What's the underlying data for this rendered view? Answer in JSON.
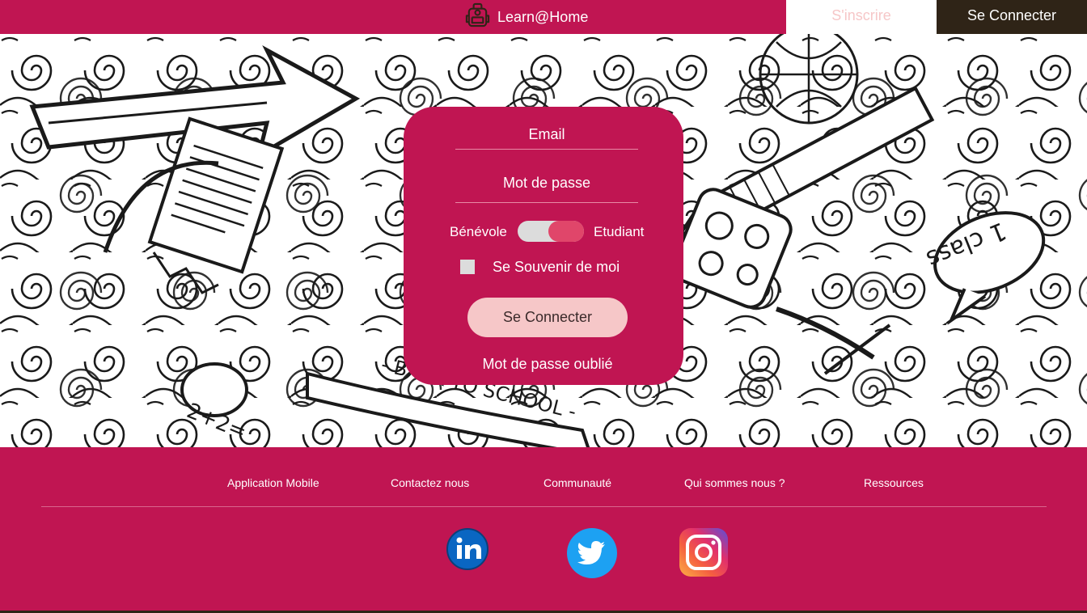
{
  "header": {
    "brand_name": "Learn@Home",
    "signup_label": "S'inscrire",
    "login_label": "Se Connecter"
  },
  "hero": {
    "illustration_text": {
      "back_to_school": "- BACK TO SCHOOL -",
      "math": "2+2=",
      "class": "1 class"
    }
  },
  "login_form": {
    "email_placeholder": "Email",
    "password_placeholder": "Mot de passe",
    "toggle_left_label": "Bénévole",
    "toggle_right_label": "Etudiant",
    "toggle_state": "Etudiant",
    "remember_label": "Se Souvenir de moi",
    "remember_checked": false,
    "submit_label": "Se Connecter",
    "forgot_label": "Mot de passe oublié"
  },
  "footer": {
    "links": [
      "Application Mobile",
      "Contactez nous",
      "Communauté",
      "Qui sommes nous ?",
      "Ressources"
    ],
    "social_icons": [
      "linkedin-icon",
      "twitter-icon",
      "instagram-icon"
    ]
  },
  "colors": {
    "brand": "#c01552",
    "dark": "#2f2417",
    "pink_light": "#f6c7c8",
    "toggle_accent": "#e0466a"
  }
}
